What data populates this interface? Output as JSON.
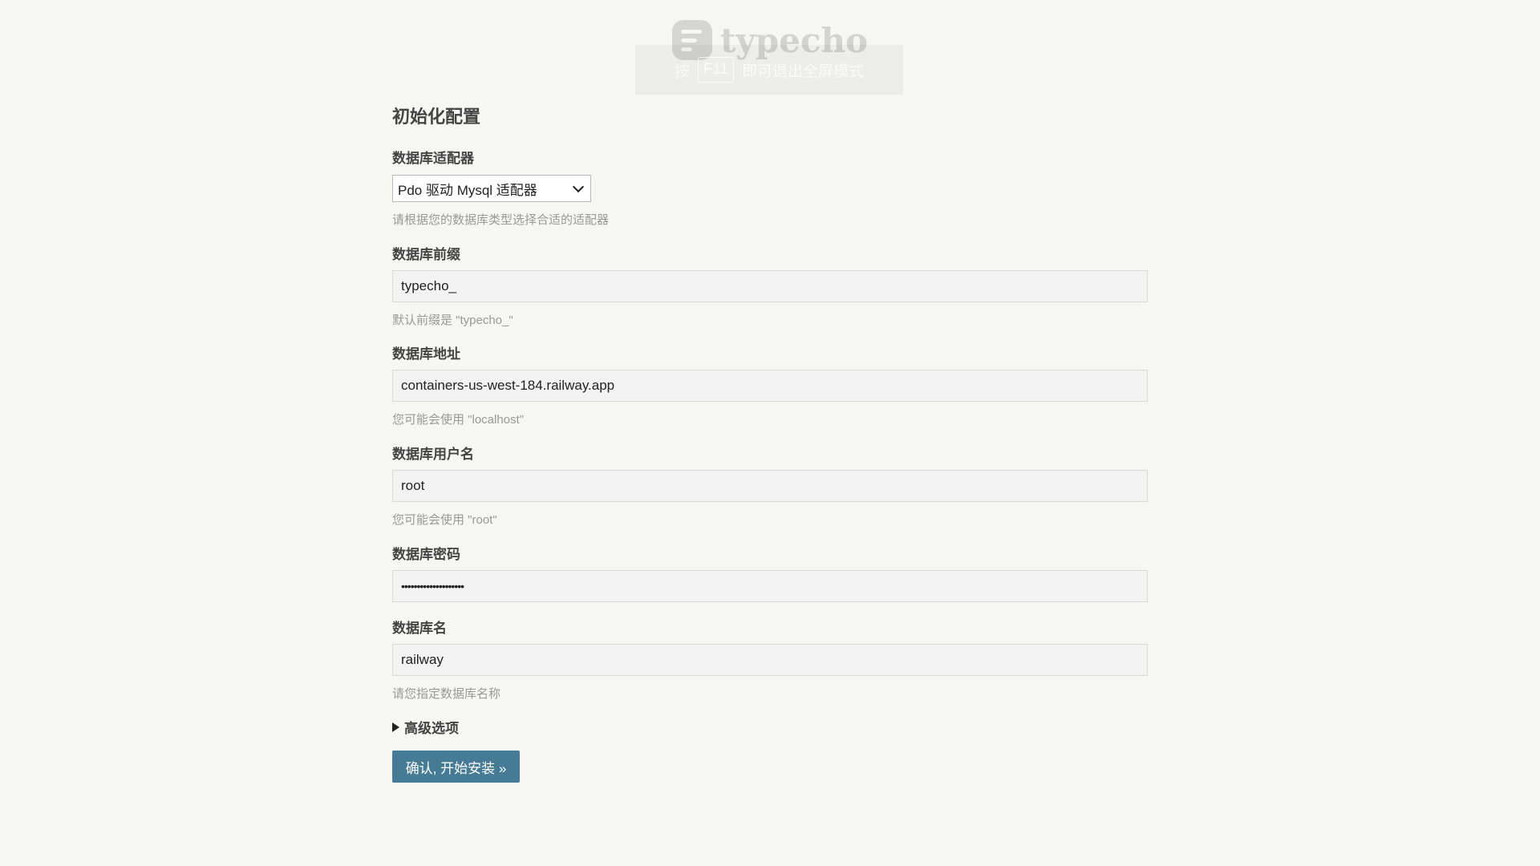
{
  "logo": {
    "text": "typecho"
  },
  "fullscreen_hint": {
    "before": "按",
    "key": "F11",
    "after": "即可退出全屏模式"
  },
  "page_title": "初始化配置",
  "fields": {
    "adapter": {
      "label": "数据库适配器",
      "selected": "Pdo 驱动 Mysql 适配器",
      "desc": "请根据您的数据库类型选择合适的适配器"
    },
    "prefix": {
      "label": "数据库前缀",
      "value": "typecho_",
      "desc": "默认前缀是 \"typecho_\""
    },
    "host": {
      "label": "数据库地址",
      "value": "containers-us-west-184.railway.app",
      "desc": "您可能会使用 \"localhost\""
    },
    "user": {
      "label": "数据库用户名",
      "value": "root",
      "desc": "您可能会使用 \"root\""
    },
    "password": {
      "label": "数据库密码",
      "value": "••••••••••••••••••••"
    },
    "dbname": {
      "label": "数据库名",
      "value": "railway",
      "desc": "请您指定数据库名称"
    }
  },
  "advanced_label": "高级选项",
  "submit_label": "确认, 开始安装 »",
  "colors": {
    "background": "#f6f6f3",
    "button": "#467b96"
  }
}
